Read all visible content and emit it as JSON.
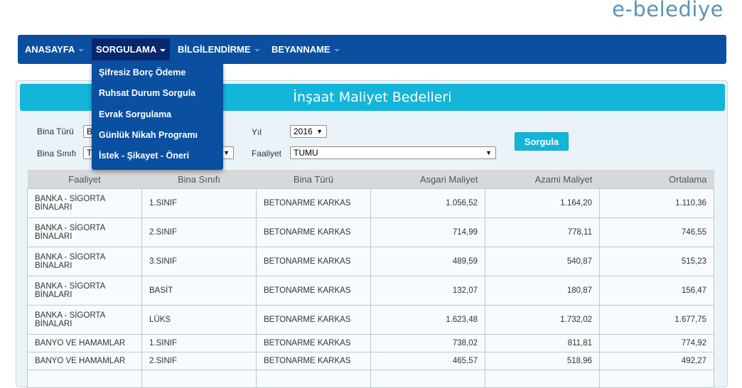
{
  "brand": "e-belediye",
  "nav": {
    "items": [
      {
        "label": "ANASAYFA"
      },
      {
        "label": "SORGULAMA"
      },
      {
        "label": "BİLGİLENDİRME"
      },
      {
        "label": "BEYANNAME"
      }
    ],
    "dropdown": [
      "Şifresiz Borç Ödeme",
      "Ruhsat Durum Sorgula",
      "Evrak Sorgulama",
      "Günlük Nikah Programı",
      "İstek - Şikayet - Öneri"
    ]
  },
  "panel": {
    "title": "İnşaat Maliyet Bedelleri"
  },
  "filters": {
    "bina_turu_label": "Bina Türü",
    "bina_turu_value": "B",
    "bina_sinifi_label": "Bina Sınıfı",
    "bina_sinifi_value": "T",
    "yil_label": "Yıl",
    "yil_value": "2016",
    "faaliyet_label": "Faaliyet",
    "faaliyet_value": "TUMU",
    "submit_label": "Sorgula"
  },
  "table": {
    "headers": [
      "Faaliyet",
      "Bina Sınıfı",
      "Bina Türü",
      "Asgari Maliyet",
      "Azami Maliyet",
      "Ortalama"
    ],
    "rows": [
      [
        "BANKA - SİGORTA BİNALARI",
        "1.SINIF",
        "BETONARME KARKAS",
        "1.056,52",
        "1.164,20",
        "1.110,36"
      ],
      [
        "BANKA - SİGORTA BİNALARI",
        "2.SINIF",
        "BETONARME KARKAS",
        "714,99",
        "778,11",
        "746,55"
      ],
      [
        "BANKA - SİGORTA BİNALARI",
        "3.SINIF",
        "BETONARME KARKAS",
        "489,59",
        "540,87",
        "515,23"
      ],
      [
        "BANKA - SİGORTA BİNALARI",
        "BASİT",
        "BETONARME KARKAS",
        "132,07",
        "180,87",
        "156,47"
      ],
      [
        "BANKA - SİGORTA BİNALARI",
        "LÜKS",
        "BETONARME KARKAS",
        "1.623,48",
        "1.732,02",
        "1.677,75"
      ],
      [
        "BANYO VE HAMAMLAR",
        "1.SINIF",
        "BETONARME KARKAS",
        "738,02",
        "811,81",
        "774,92"
      ],
      [
        "BANYO VE HAMAMLAR",
        "2.SINIF",
        "BETONARME KARKAS",
        "465,57",
        "518,96",
        "492,27"
      ],
      [
        "",
        "",
        "",
        "",
        "",
        ""
      ]
    ]
  }
}
